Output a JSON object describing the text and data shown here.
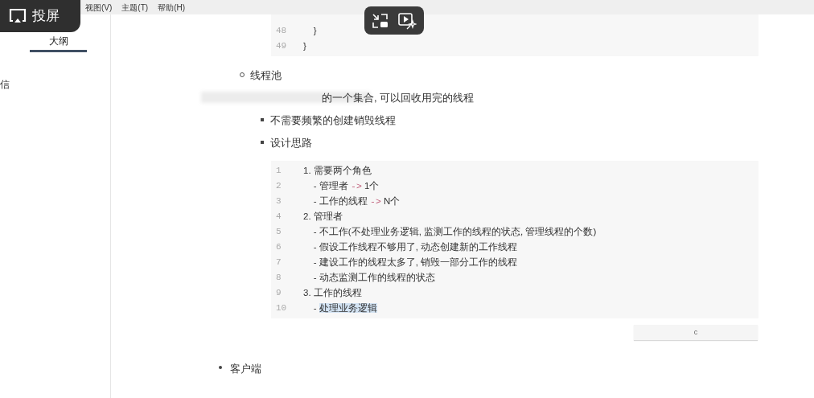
{
  "menu_bar": {
    "items": [
      "视图(V)",
      "主题(T)",
      "帮助(H)"
    ]
  },
  "sidebar": {
    "tabs": [
      {
        "label": "大纲",
        "selected": true
      }
    ],
    "items": [
      "信"
    ]
  },
  "overlay": {
    "cast_button": {
      "label": "投屏"
    }
  },
  "document": {
    "code_block_top": {
      "lines": [
        {
          "number": "48",
          "parts": [
            {
              "text": "    }",
              "kind": "plain"
            }
          ]
        },
        {
          "number": "49",
          "parts": [
            {
              "text": "}",
              "kind": "plain"
            }
          ]
        }
      ]
    },
    "heading_item": {
      "text": "线程池"
    },
    "paragraph": {
      "text": "的一个集合, 可以回收用完的线程"
    },
    "sub_items": [
      "不需要频繁的创建销毁线程",
      "设计思路"
    ],
    "code_block": {
      "lines": [
        {
          "number": "1",
          "parts": [
            {
              "text": "1. 需要两个角色",
              "kind": "plain"
            }
          ]
        },
        {
          "number": "2",
          "parts": [
            {
              "text": "    - 管理者 ",
              "kind": "plain"
            },
            {
              "text": "->",
              "kind": "operator"
            },
            {
              "text": " 1个",
              "kind": "plain"
            }
          ]
        },
        {
          "number": "3",
          "parts": [
            {
              "text": "    - 工作的线程 ",
              "kind": "plain"
            },
            {
              "text": "->",
              "kind": "operator"
            },
            {
              "text": " N个",
              "kind": "plain"
            }
          ]
        },
        {
          "number": "4",
          "parts": [
            {
              "text": "2. 管理者",
              "kind": "plain"
            }
          ]
        },
        {
          "number": "5",
          "parts": [
            {
              "text": "    - 不工作(不处理业务逻辑, 监测工作的线程的状态, 管理线程的个数)",
              "kind": "plain"
            }
          ]
        },
        {
          "number": "6",
          "parts": [
            {
              "text": "    - 假设工作线程不够用了, 动态创建新的工作线程",
              "kind": "plain"
            }
          ]
        },
        {
          "number": "7",
          "parts": [
            {
              "text": "    - 建设工作的线程太多了, 销毁一部分工作的线程",
              "kind": "plain"
            }
          ]
        },
        {
          "number": "8",
          "parts": [
            {
              "text": "    - 动态监测工作的线程的状态",
              "kind": "plain"
            }
          ]
        },
        {
          "number": "9",
          "parts": [
            {
              "text": "3. 工作的线程",
              "kind": "plain"
            }
          ]
        },
        {
          "number": "10",
          "parts": [
            {
              "text": "    - ",
              "kind": "plain"
            },
            {
              "text": "处理业务逻辑",
              "kind": "selection"
            }
          ]
        }
      ]
    },
    "language_button": {
      "label": "c"
    },
    "top_item": {
      "text": "客户端"
    }
  }
}
